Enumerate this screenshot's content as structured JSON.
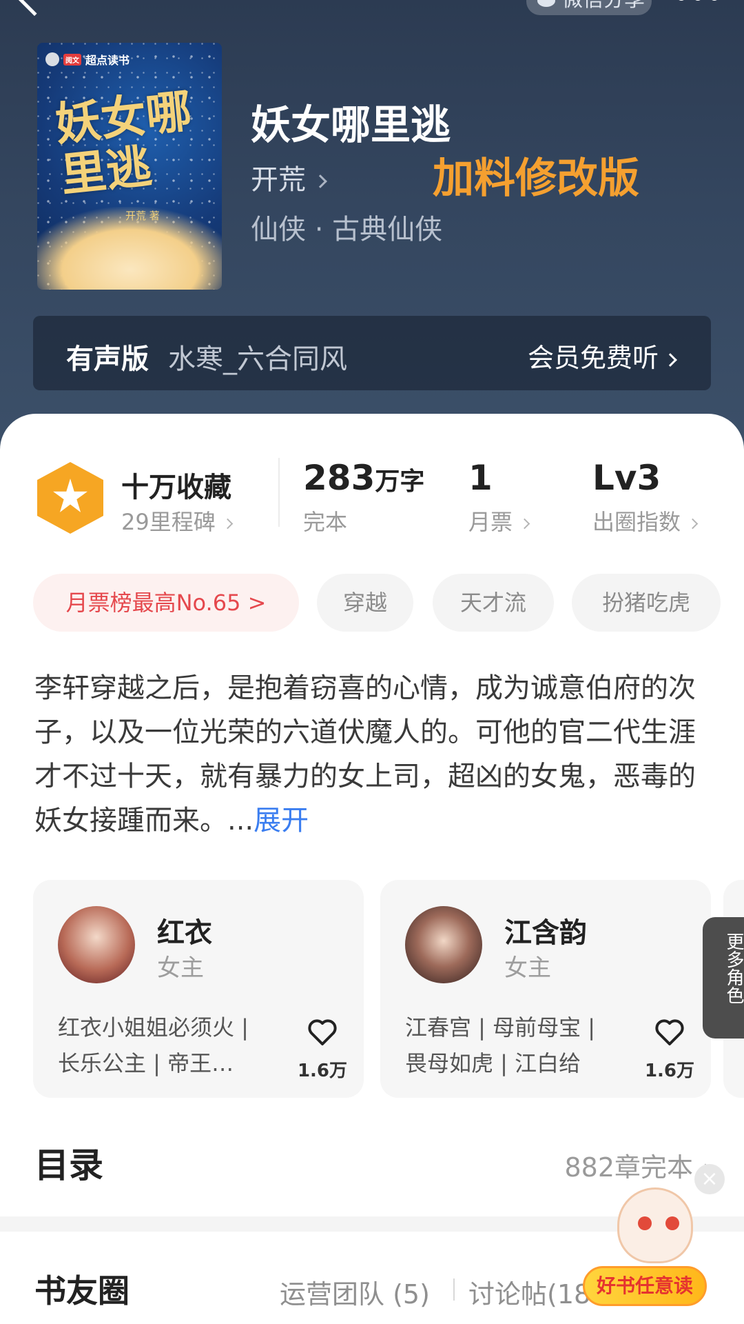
{
  "header": {
    "share_label": "微信分享",
    "cover": {
      "publisher": "超点读书",
      "publisher_badge": "阅文",
      "title_art": "妖女哪里逃",
      "author_art": "开荒 著"
    },
    "book_title": "妖女哪里逃",
    "author": "开荒",
    "overlay_label": "加料修改版",
    "genre": "仙侠 · 古典仙侠",
    "audio": {
      "label": "有声版",
      "narrator": "水寒_六合同风",
      "action": "会员免费听"
    }
  },
  "stats": {
    "favorites": "十万收藏",
    "milestones": "29里程碑",
    "word_count": "283",
    "word_unit": "万字",
    "status": "完本",
    "monthly_tickets": "1",
    "monthly_tickets_label": "月票",
    "level": "Lv3",
    "level_label": "出圈指数"
  },
  "tags": [
    "月票榜最高No.65 >",
    "穿越",
    "天才流",
    "扮猪吃虎"
  ],
  "synopsis": {
    "text": "李轩穿越之后，是抱着窃喜的心情，成为诚意伯府的次子，以及一位光荣的六道伏魔人的。可他的官二代生涯才不过十天，就有暴力的女上司，超凶的女鬼，恶毒的妖女接踵而来。...",
    "expand": "展开"
  },
  "characters": [
    {
      "name": "红衣",
      "role": "女主",
      "tags_line1": "红衣小姐姐必须火 |",
      "tags_line2": "长乐公主 | 帝王…",
      "likes": "1.6万"
    },
    {
      "name": "江含韵",
      "role": "女主",
      "tags_line1": "江春宫 | 母前母宝 |",
      "tags_line2": "畏母如虎 | 江白给",
      "likes": "1.6万"
    }
  ],
  "more_roles": "更多角色",
  "toc": {
    "title": "目录",
    "count": "882章完本"
  },
  "circle": {
    "title": "书友圈",
    "tab_team": "运营团队 (5)",
    "tab_posts": "讨论帖(18"
  },
  "mascot": {
    "banner": "好书任意读",
    "close": "×"
  },
  "colors": {
    "accent_orange": "#f5a030",
    "rank_red": "#e5484d",
    "link_blue": "#3a7df0",
    "badge_orange": "#f6a623"
  }
}
